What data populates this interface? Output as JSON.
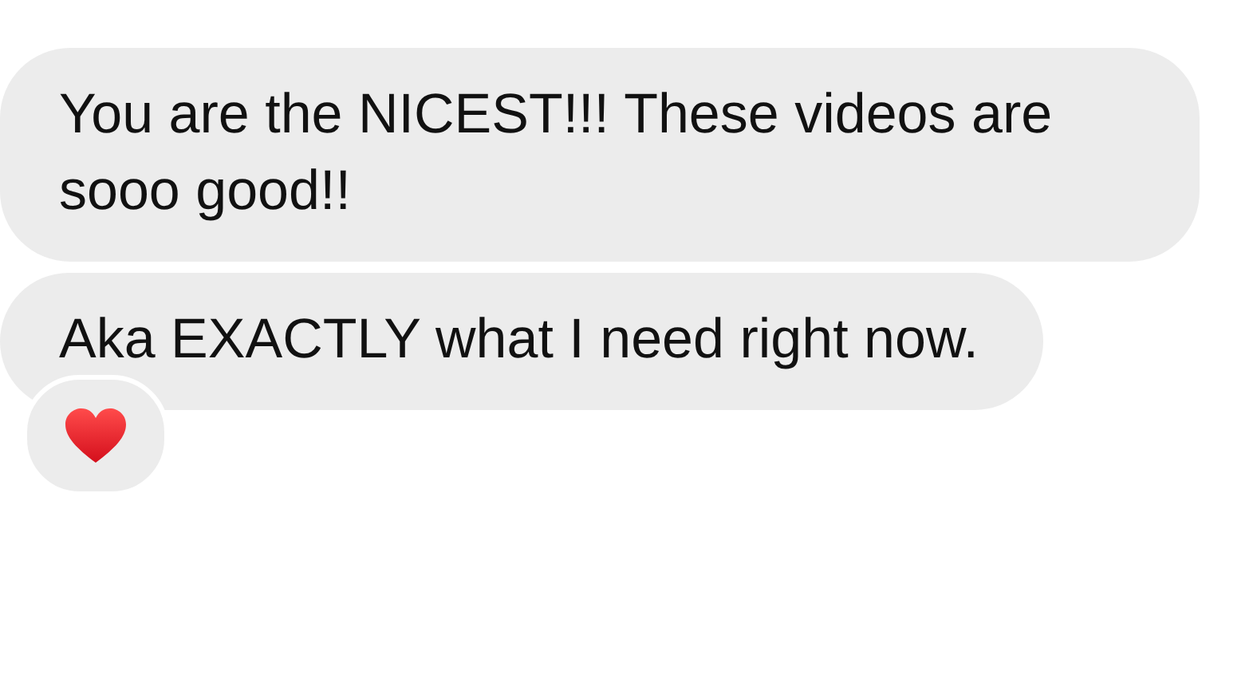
{
  "messages": [
    {
      "text": "You are the NICEST!!! These videos are sooo good!!",
      "reacted": false
    },
    {
      "text": "Aka EXACTLY what I need right now.",
      "reacted": true
    }
  ]
}
